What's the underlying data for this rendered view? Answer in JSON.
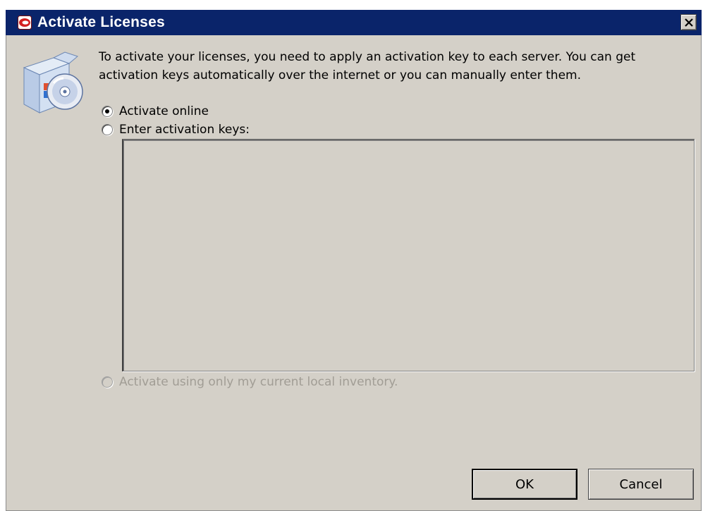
{
  "window": {
    "title": "Activate Licenses",
    "close_icon": "close-icon",
    "title_icon": "app-logo-icon"
  },
  "main": {
    "icon": "software-install-cd-icon",
    "description": "To activate your licenses, you need to apply an activation key to each server. You can get activation keys automatically over the internet or you can manually enter them."
  },
  "options": [
    {
      "label": "Activate online",
      "selected": true,
      "enabled": true
    },
    {
      "label": "Enter activation keys:",
      "selected": false,
      "enabled": true
    },
    {
      "label": "Activate using only my current local inventory.",
      "selected": false,
      "enabled": false
    }
  ],
  "keys_input": {
    "value": "",
    "placeholder": ""
  },
  "buttons": {
    "ok": "OK",
    "cancel": "Cancel"
  },
  "colors": {
    "titlebar": "#0a246a",
    "dialog_bg": "#d4d0c8",
    "disabled_text": "#a19d95"
  }
}
